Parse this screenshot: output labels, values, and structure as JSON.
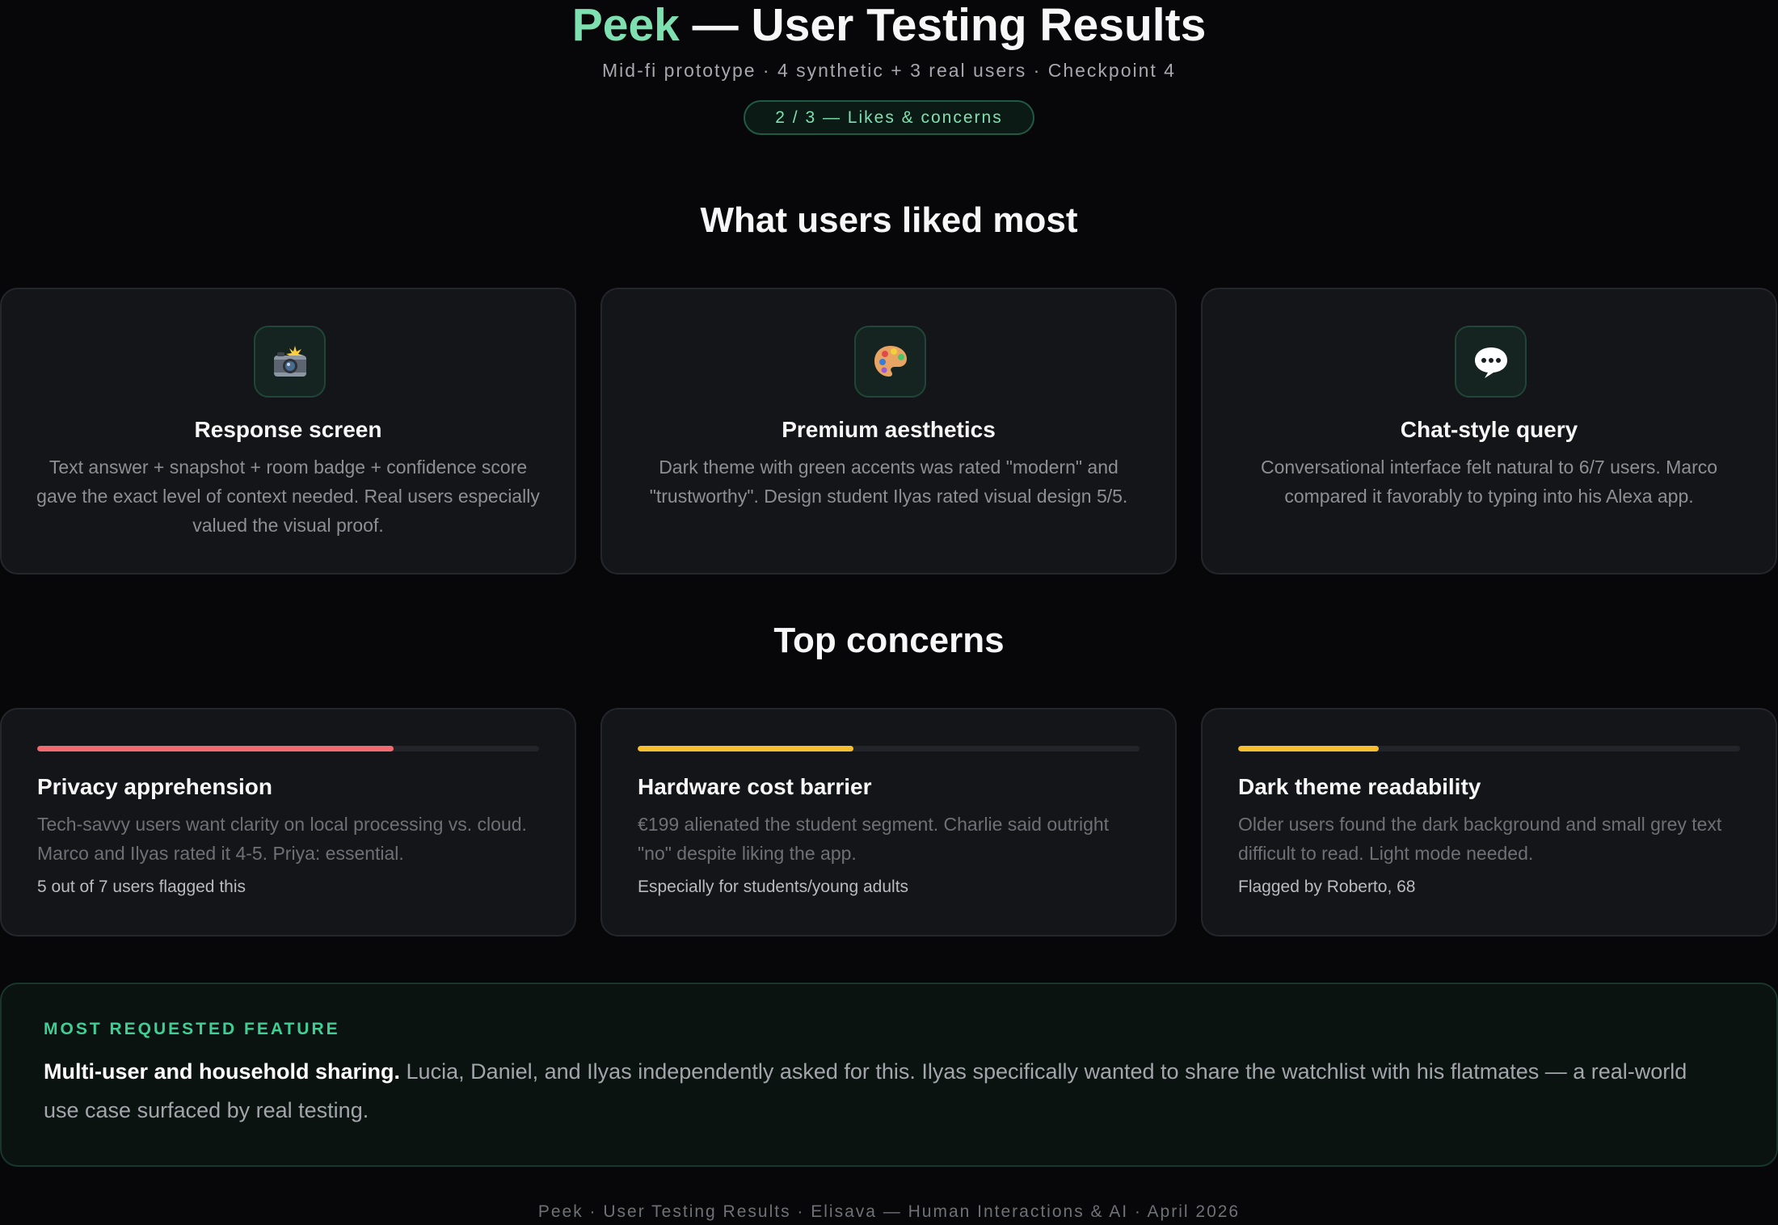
{
  "header": {
    "brand": "Peek",
    "title_rest": " — User Testing Results",
    "subtitle": "Mid-fi prototype · 4 synthetic + 3 real users · Checkpoint 4",
    "badge": "2 / 3 — Likes & concerns"
  },
  "liked": {
    "heading": "What users liked most",
    "cards": [
      {
        "icon": "camera-flash-icon",
        "title": "Response screen",
        "desc": "Text answer + snapshot + room badge + confidence score gave the exact level of context needed. Real users especially valued the visual proof."
      },
      {
        "icon": "palette-icon",
        "title": "Premium aesthetics",
        "desc": "Dark theme with green accents was rated \"modern\" and \"trustworthy\". Design student Ilyas rated visual design 5/5."
      },
      {
        "icon": "speech-bubble-icon",
        "title": "Chat-style query",
        "desc": "Conversational interface felt natural to 6/7 users. Marco compared it favorably to typing into his Alexa app."
      }
    ]
  },
  "concerns": {
    "heading": "Top concerns",
    "cards": [
      {
        "title": "Privacy apprehension",
        "desc": "Tech-savvy users want clarity on local processing vs. cloud. Marco and Ilyas rated it 4-5. Priya: essential.",
        "note": "5 out of 7 users flagged this",
        "severity": 0.71,
        "color": "#f06a6f"
      },
      {
        "title": "Hardware cost barrier",
        "desc": "€199 alienated the student segment. Charlie said outright \"no\" despite liking the app.",
        "note": "Especially for students/young adults",
        "severity": 0.43,
        "color": "#f7be2f"
      },
      {
        "title": "Dark theme readability",
        "desc": "Older users found the dark background and small grey text difficult to read. Light mode needed.",
        "note": "Flagged by Roberto, 68",
        "severity": 0.28,
        "color": "#f7be2f"
      }
    ]
  },
  "feature": {
    "label": "MOST REQUESTED FEATURE",
    "bold": "Multi-user and household sharing.",
    "text": " Lucia, Daniel, and Ilyas independently asked for this. Ilyas specifically wanted to share the watchlist with his flatmates — a real-world use case surfaced by real testing."
  },
  "footer": "Peek · User Testing Results · Elisava — Human Interactions & AI · April 2026"
}
